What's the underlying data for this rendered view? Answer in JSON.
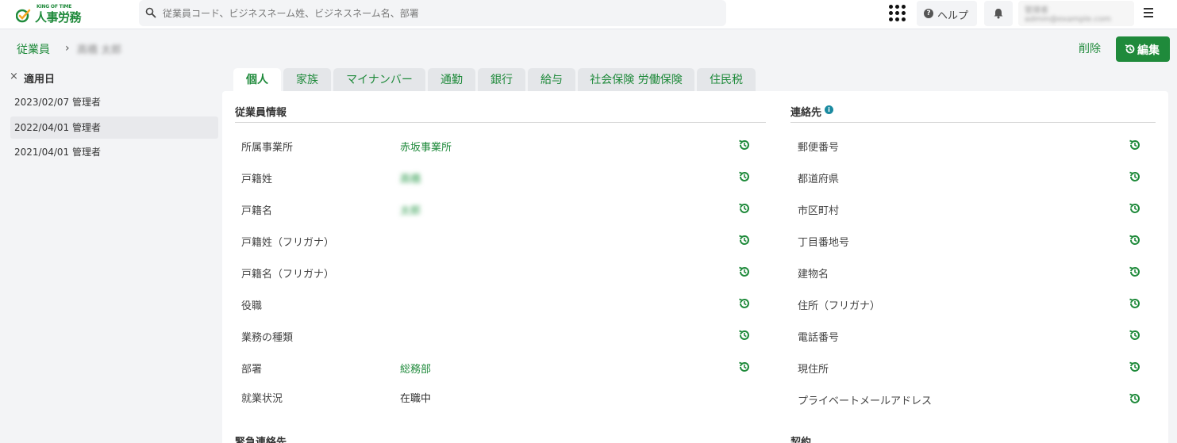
{
  "header": {
    "logo_small": "KING OF TIME",
    "logo_big": "人事労務",
    "search_placeholder": "従業員コード、ビジネスネーム姓、ビジネスネーム名、部署",
    "help_label": "ヘルプ",
    "user_line1": "管理者",
    "user_line2": "admin@example.com"
  },
  "breadcrumb": {
    "parent": "従業員",
    "current": "高橋 太郎"
  },
  "actions": {
    "delete_label": "削除",
    "edit_label": "編集"
  },
  "sidebar": {
    "title": "適用日",
    "items": [
      {
        "label": "2023/02/07 管理者"
      },
      {
        "label": "2022/04/01 管理者"
      },
      {
        "label": "2021/04/01 管理者"
      }
    ]
  },
  "tabs": [
    {
      "label": "個人"
    },
    {
      "label": "家族"
    },
    {
      "label": "マイナンバー"
    },
    {
      "label": "通勤"
    },
    {
      "label": "銀行"
    },
    {
      "label": "給与"
    },
    {
      "label": "社会保険 労働保険"
    },
    {
      "label": "住民税"
    }
  ],
  "employee_info": {
    "title": "従業員情報",
    "rows": [
      {
        "label": "所属事業所",
        "value": "赤坂事業所"
      },
      {
        "label": "戸籍姓",
        "value": "高橋"
      },
      {
        "label": "戸籍名",
        "value": "太郎"
      },
      {
        "label": "戸籍姓（フリガナ）",
        "value": ""
      },
      {
        "label": "戸籍名（フリガナ）",
        "value": ""
      },
      {
        "label": "役職",
        "value": ""
      },
      {
        "label": "業務の種類",
        "value": ""
      },
      {
        "label": "部署",
        "value": "総務部"
      },
      {
        "label": "就業状況",
        "value": "在職中"
      }
    ]
  },
  "contact": {
    "title": "連絡先",
    "rows": [
      {
        "label": "郵便番号"
      },
      {
        "label": "都道府県"
      },
      {
        "label": "市区町村"
      },
      {
        "label": "丁目番地号"
      },
      {
        "label": "建物名"
      },
      {
        "label": "住所（フリガナ）"
      },
      {
        "label": "電話番号"
      },
      {
        "label": "現住所"
      },
      {
        "label": "プライベートメールアドレス"
      }
    ]
  },
  "bottom_sections": {
    "left": "緊急連絡先",
    "right": "契約"
  },
  "colors": {
    "brand": "#1f8a3b",
    "info": "#1a8aa0"
  }
}
